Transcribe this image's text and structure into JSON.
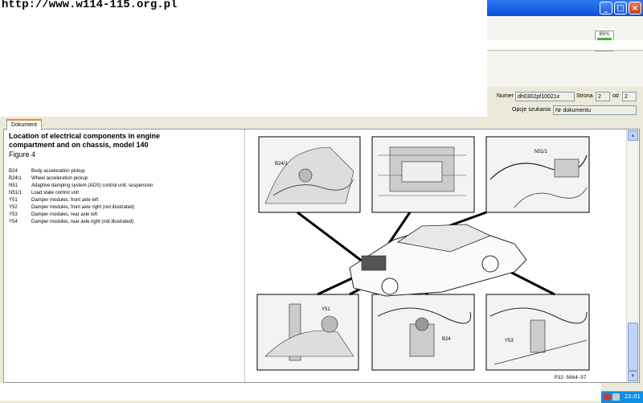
{
  "overlay": {
    "url": "http://www.w114-115.org.pl"
  },
  "window": {
    "minimize": "_",
    "maximize": "□",
    "close": "×"
  },
  "progress_widget": {
    "label": "89%"
  },
  "fields": {
    "numer_label": "Numer",
    "numer_value": "dh0302pf10021x",
    "strona_label": "Strona",
    "strona_value": "2",
    "od_label": "od",
    "od_value": "2",
    "opcje_label": "Opcje szukania",
    "opcje_value": "Nr dokumentu"
  },
  "tab": {
    "label": "Dokument"
  },
  "document": {
    "title": "Location of electrical components in engine compartment and on chassis, model 140",
    "figure": "Figure 4",
    "legend": [
      {
        "code": "B24",
        "text": "Body acceleration pickup"
      },
      {
        "code": "B24/1",
        "text": "Wheel acceleration pickup"
      },
      {
        "code": "N51",
        "text": "Adaptive damping system (ADS) control unit, suspension"
      },
      {
        "code": "N51/1",
        "text": "Load state control unit"
      },
      {
        "code": "Y51",
        "text": "Damper modules, front axle left"
      },
      {
        "code": "Y52",
        "text": "Damper modules, front axle right (not illustrated)"
      },
      {
        "code": "Y53",
        "text": "Damper modules, rear axle left"
      },
      {
        "code": "Y54",
        "text": "Damper modules, rear axle right (not illustrated)"
      }
    ],
    "diagram_labels": {
      "b24_1": "B24/1",
      "n51_1": "N51/1",
      "y51": "Y51",
      "b24": "B24",
      "y53": "Y53",
      "ref": "P32-5064-57"
    }
  },
  "scrollbar": {
    "up": "▲",
    "down": "▼"
  },
  "taskbar": {
    "time": "22:01"
  },
  "colors": {
    "accent": "#0a52d8",
    "tab_highlight": "#e68b2c",
    "progress_fill": "#49b03a",
    "taskbar": "#0f8de3"
  }
}
